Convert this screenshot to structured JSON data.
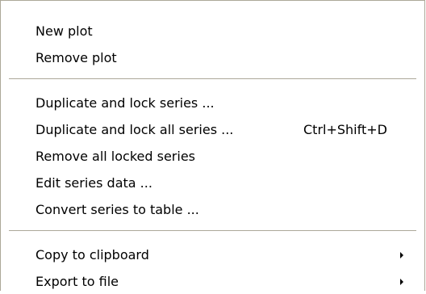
{
  "menu": {
    "group1": [
      {
        "label": "New plot"
      },
      {
        "label": "Remove plot"
      }
    ],
    "group2": [
      {
        "label": "Duplicate and lock series ..."
      },
      {
        "label": "Duplicate and lock all series ...",
        "shortcut": "Ctrl+Shift+D"
      },
      {
        "label": "Remove all locked series"
      },
      {
        "label": "Edit series data ..."
      },
      {
        "label": "Convert series to table ..."
      }
    ],
    "group3": [
      {
        "label": "Copy to clipboard",
        "submenu_icon": "submenu-arrow-icon"
      },
      {
        "label": "Export to file",
        "submenu_icon": "submenu-arrow-icon"
      }
    ]
  }
}
